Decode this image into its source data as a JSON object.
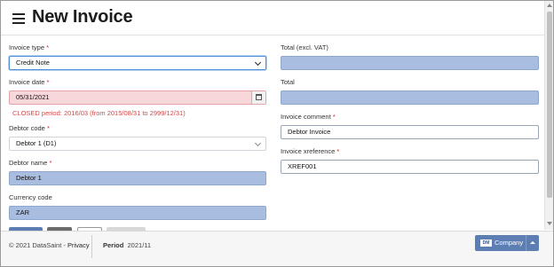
{
  "header": {
    "title": "New Invoice"
  },
  "form": {
    "invoice_type": {
      "label": "Invoice type",
      "required_mark": "*",
      "value": "Credit Note"
    },
    "invoice_date": {
      "label": "Invoice date",
      "required_mark": "*",
      "value": "05/31/2021",
      "error": "CLOSED period: 2016/03 (from 2015/08/31 to 2999/12/31)"
    },
    "debtor_code": {
      "label": "Debtor code",
      "required_mark": "*",
      "value": "Debtor 1 (D1)"
    },
    "debtor_name": {
      "label": "Debtor name",
      "required_mark": "*",
      "value": "Debtor 1"
    },
    "currency_code": {
      "label": "Currency code",
      "value": "ZAR"
    },
    "total_excl_vat": {
      "label": "Total (excl. VAT)",
      "value": ""
    },
    "total": {
      "label": "Total",
      "value": ""
    },
    "invoice_comment": {
      "label": "Invoice comment",
      "required_mark": "*",
      "value": "Debtor Invoice"
    },
    "invoice_xreference": {
      "label": "Invoice xreference",
      "required_mark": "*",
      "value": "XREF001"
    }
  },
  "footer": {
    "copyright": "© 2021 DataSaint - ",
    "privacy_link": "Privacy",
    "period_label": "Period",
    "period_value": "2021/11",
    "company_logo_text": "DM",
    "company_button_label": "Company"
  },
  "colors": {
    "filled_field": "#a9bde0",
    "error_text": "#d14a4a",
    "required_asterisk": "#d9232e",
    "company_button": "#5c7eb3"
  }
}
